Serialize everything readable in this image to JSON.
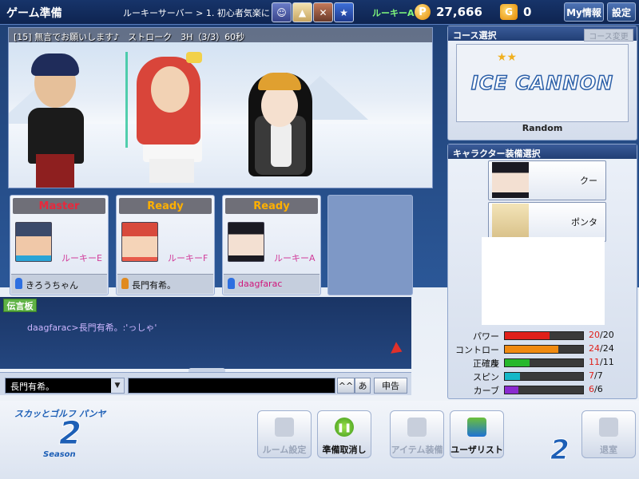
{
  "topbar": {
    "title": "ゲーム準備",
    "server": "ルーキーサーバー > 1. 初心者気楽に",
    "player_name": "ルーキーA",
    "coin_icon": "P",
    "coins": "27,666",
    "gift_icon": "G",
    "gift_count": "0",
    "my_info_label": "My情報",
    "settings_label": "設定",
    "icon_names": [
      "avatar-icon",
      "cat-icon",
      "cross-icon",
      "star-icon"
    ]
  },
  "game": {
    "room_info": "[15] 無言でお願いします♪　ストローク　3H（3/3）60秒"
  },
  "players": [
    {
      "status": "Master",
      "status_color": "#e8283c",
      "name": "ルーキーE",
      "user": "きろうちゃん",
      "user_color": "#111111",
      "icon_color": "#2e6fe0"
    },
    {
      "status": "Ready",
      "status_color": "#ffb000",
      "name": "ルーキーF",
      "user": "長門有希。",
      "user_color": "#111111",
      "icon_color": "#e08a20"
    },
    {
      "status": "Ready",
      "status_color": "#ffb000",
      "name": "ルーキーA",
      "user": "daagfarac",
      "user_color": "#d0147a",
      "icon_color": "#2e6fe0"
    }
  ],
  "chat": {
    "board_label": "伝言板",
    "line": "daagfarac>長門有希。:'っしゃ'",
    "target": "長門有希。",
    "dropdown_arrow": "▼",
    "ime_label": "^^",
    "kana_label": "あ",
    "report_label": "申告"
  },
  "course": {
    "header": "コース選択",
    "change_label": "コース変更",
    "logo_text": "ICE CANNON",
    "stars": "★★",
    "name": "Random"
  },
  "character": {
    "header": "キャラクター装備選択",
    "rows": [
      {
        "label": "クー"
      },
      {
        "label": "ポンタ"
      }
    ],
    "stats": [
      {
        "label": "パワー",
        "value": 20,
        "max": 20,
        "color": "#e0201a"
      },
      {
        "label": "コントロール",
        "value": 24,
        "max": 24,
        "color": "#f08a10"
      },
      {
        "label": "正確度",
        "value": 11,
        "max": 11,
        "color": "#27b82c"
      },
      {
        "label": "スピン",
        "value": 7,
        "max": 7,
        "color": "#16b8c8"
      },
      {
        "label": "カーブ",
        "value": 6,
        "max": 6,
        "color": "#8a2ad0"
      }
    ]
  },
  "bottom": {
    "logo_text": "スカッとゴルフ パンヤ",
    "logo_number": "2",
    "logo_season": "Season",
    "buttons": [
      {
        "label": "ルーム設定",
        "enabled": false
      },
      {
        "label": "準備取消し",
        "enabled": true
      },
      {
        "label": "アイテム装備",
        "enabled": false
      },
      {
        "label": "ユーザリスト",
        "enabled": true
      },
      {
        "label": "退室",
        "enabled": false
      }
    ]
  }
}
